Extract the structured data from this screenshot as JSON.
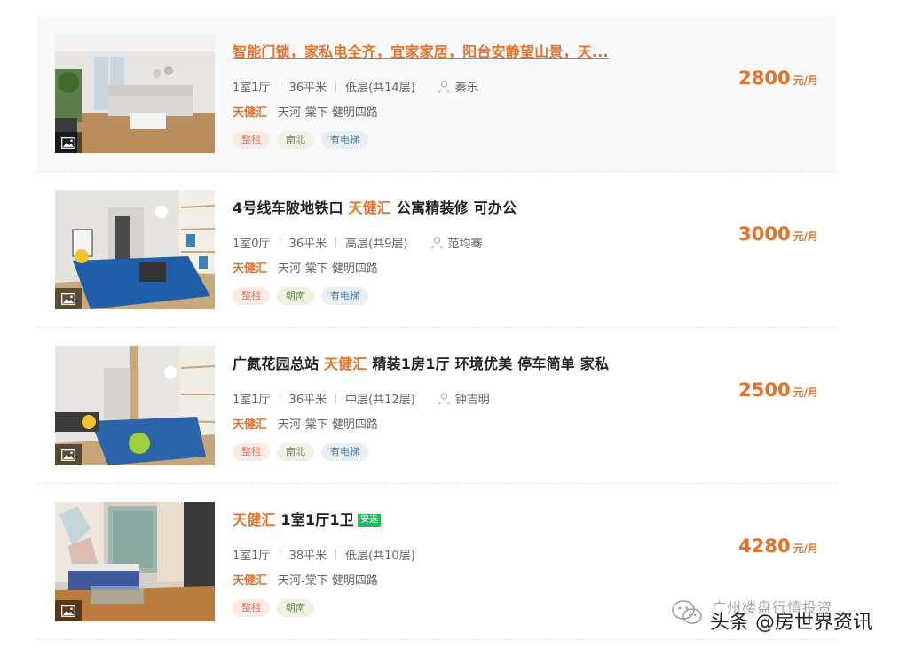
{
  "listings": [
    {
      "title_plain": "智能门锁，家私电全齐，宜家家居，阳台安静望山景，天...",
      "layout": "1室1厅",
      "area": "36平米",
      "floor": "低层(共14层)",
      "agent": "秦乐",
      "community": "天健汇",
      "district": "天河-棠下 健明四路",
      "tags": [
        "整租",
        "南北",
        "有电梯"
      ],
      "price": "2800",
      "unit": "元/月"
    },
    {
      "title_pre": "4号线车陂地铁口 ",
      "title_hl": "天健汇",
      "title_post": " 公寓精装修 可办公",
      "layout": "1室0厅",
      "area": "36平米",
      "floor": "高层(共9层)",
      "agent": "范均骞",
      "community": "天健汇",
      "district": "天河-棠下 健明四路",
      "tags": [
        "整租",
        "朝南",
        "有电梯"
      ],
      "price": "3000",
      "unit": "元/月"
    },
    {
      "title_pre": "广氮花园总站 ",
      "title_hl": "天健汇",
      "title_post": " 精装1房1厅 环境优美 停车简单 家私",
      "layout": "1室1厅",
      "area": "36平米",
      "floor": "中层(共12层)",
      "agent": "钟吉明",
      "community": "天健汇",
      "district": "天河-棠下 健明四路",
      "tags": [
        "整租",
        "南北",
        "有电梯"
      ],
      "price": "2500",
      "unit": "元/月"
    },
    {
      "title_hl": "天健汇",
      "title_post": " 1室1厅1卫",
      "badge": "安选",
      "layout": "1室1厅",
      "area": "38平米",
      "floor": "低层(共10层)",
      "community": "天健汇",
      "district": "天河-棠下 健明四路",
      "tags": [
        "整租",
        "朝南"
      ],
      "price": "4280",
      "unit": "元/月"
    }
  ],
  "watermark": {
    "small": "广州楼盘行情投资",
    "big": "头条 @房世界资讯"
  },
  "colors": {
    "accent": "#e4712a",
    "badge_green": "#1fb85b"
  }
}
